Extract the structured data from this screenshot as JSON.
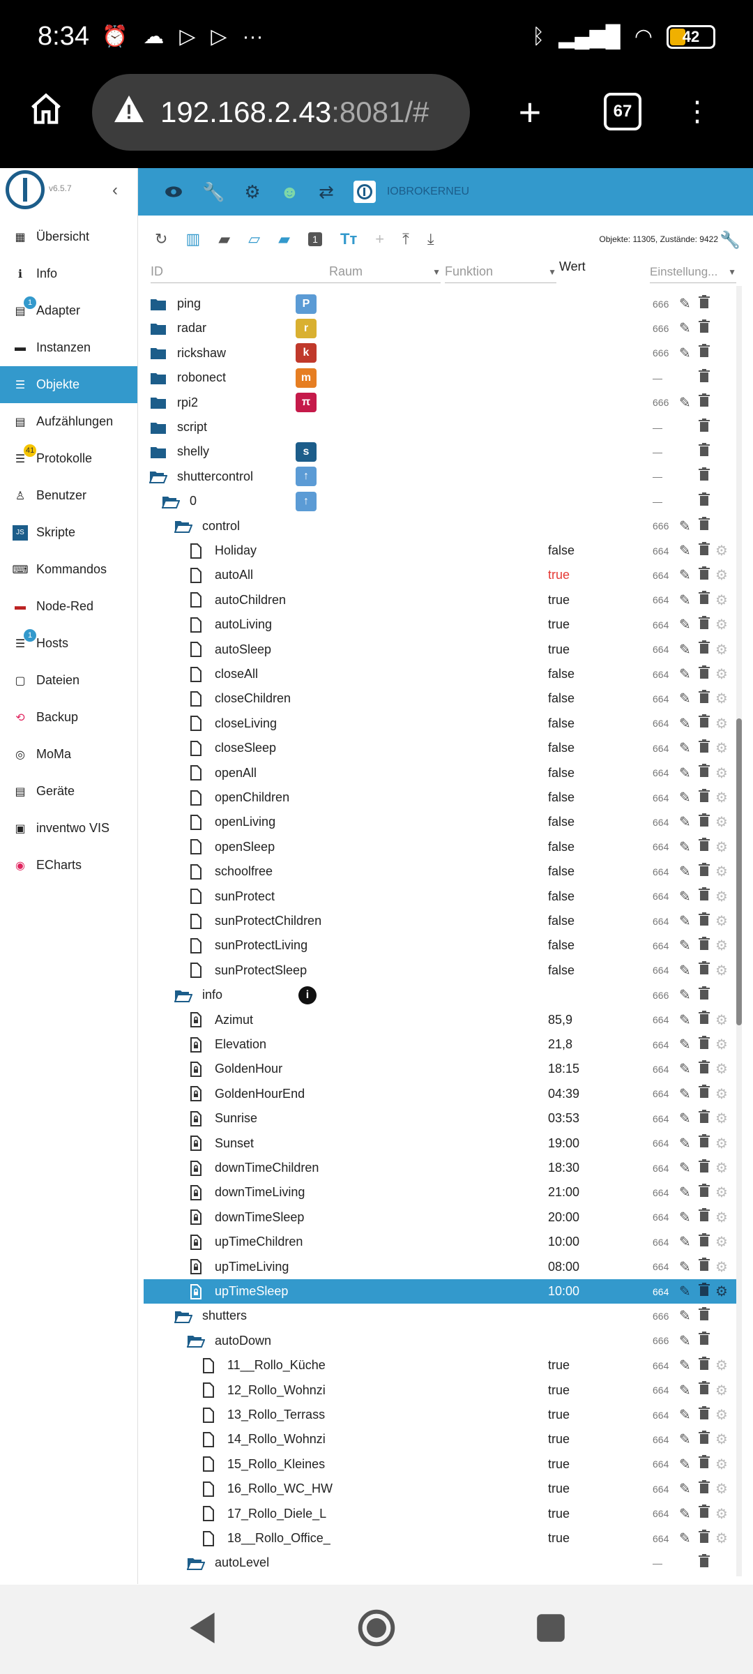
{
  "status": {
    "time": "8:34",
    "battery": "42"
  },
  "browser": {
    "url_host": "192.168.2.43",
    "url_port": ":8081/#",
    "tabs": "67"
  },
  "sidebar": {
    "version": "v6.5.7",
    "items": [
      {
        "label": "Übersicht",
        "icon": "grid-icon"
      },
      {
        "label": "Info",
        "icon": "info-icon"
      },
      {
        "label": "Adapter",
        "icon": "store-icon",
        "badge": "1"
      },
      {
        "label": "Instanzen",
        "icon": "instances-icon"
      },
      {
        "label": "Objekte",
        "icon": "list-icon",
        "active": true
      },
      {
        "label": "Aufzählungen",
        "icon": "enum-icon"
      },
      {
        "label": "Protokolle",
        "icon": "log-icon",
        "badge": "41"
      },
      {
        "label": "Benutzer",
        "icon": "user-icon"
      },
      {
        "label": "Skripte",
        "icon": "js-icon"
      },
      {
        "label": "Kommandos",
        "icon": "console-icon"
      },
      {
        "label": "Node-Red",
        "icon": "nodered-icon"
      },
      {
        "label": "Hosts",
        "icon": "hosts-icon",
        "badge": "1"
      },
      {
        "label": "Dateien",
        "icon": "files-icon"
      },
      {
        "label": "Backup",
        "icon": "backup-icon"
      },
      {
        "label": "MoMa",
        "icon": "moma-icon"
      },
      {
        "label": "Geräte",
        "icon": "devices-icon"
      },
      {
        "label": "inventwo VIS",
        "icon": "vis-icon"
      },
      {
        "label": "ECharts",
        "icon": "echarts-icon"
      }
    ]
  },
  "topbar": {
    "title": "IOBROKERNEU"
  },
  "toolbar": {
    "count": "Objekte: 11305, Zustände: 9422"
  },
  "filters": {
    "id": "ID",
    "room": "Raum",
    "function": "Funktion",
    "value": "Wert",
    "settings": "Einstellung..."
  },
  "rows": [
    {
      "name": "ping",
      "lvl": 0,
      "type": "folder",
      "acl": "666",
      "logo": "P"
    },
    {
      "name": "radar",
      "lvl": 0,
      "type": "folder",
      "acl": "666",
      "logo": "r"
    },
    {
      "name": "rickshaw",
      "lvl": 0,
      "type": "folder",
      "acl": "666",
      "logo": "k"
    },
    {
      "name": "robonect",
      "lvl": 0,
      "type": "folder",
      "acl": "—",
      "logo": "m"
    },
    {
      "name": "rpi2",
      "lvl": 0,
      "type": "folder",
      "acl": "666",
      "logo": "π"
    },
    {
      "name": "script",
      "lvl": 0,
      "type": "folder",
      "acl": "—"
    },
    {
      "name": "shelly",
      "lvl": 0,
      "type": "folder",
      "acl": "—",
      "logo": "s"
    },
    {
      "name": "shuttercontrol",
      "lvl": 0,
      "type": "open",
      "acl": "—",
      "logo": "↑"
    },
    {
      "name": "0",
      "lvl": 1,
      "type": "open",
      "acl": "—",
      "logo": "↑"
    },
    {
      "name": "control",
      "lvl": 2,
      "type": "open",
      "acl": "666"
    },
    {
      "name": "Holiday",
      "lvl": 3,
      "type": "file",
      "val": "false",
      "acl": "664"
    },
    {
      "name": "autoAll",
      "lvl": 3,
      "type": "file",
      "val": "true",
      "red": true,
      "acl": "664"
    },
    {
      "name": "autoChildren",
      "lvl": 3,
      "type": "file",
      "val": "true",
      "acl": "664"
    },
    {
      "name": "autoLiving",
      "lvl": 3,
      "type": "file",
      "val": "true",
      "acl": "664"
    },
    {
      "name": "autoSleep",
      "lvl": 3,
      "type": "file",
      "val": "true",
      "acl": "664"
    },
    {
      "name": "closeAll",
      "lvl": 3,
      "type": "file",
      "val": "false",
      "acl": "664"
    },
    {
      "name": "closeChildren",
      "lvl": 3,
      "type": "file",
      "val": "false",
      "acl": "664"
    },
    {
      "name": "closeLiving",
      "lvl": 3,
      "type": "file",
      "val": "false",
      "acl": "664"
    },
    {
      "name": "closeSleep",
      "lvl": 3,
      "type": "file",
      "val": "false",
      "acl": "664"
    },
    {
      "name": "openAll",
      "lvl": 3,
      "type": "file",
      "val": "false",
      "acl": "664"
    },
    {
      "name": "openChildren",
      "lvl": 3,
      "type": "file",
      "val": "false",
      "acl": "664"
    },
    {
      "name": "openLiving",
      "lvl": 3,
      "type": "file",
      "val": "false",
      "acl": "664"
    },
    {
      "name": "openSleep",
      "lvl": 3,
      "type": "file",
      "val": "false",
      "acl": "664"
    },
    {
      "name": "schoolfree",
      "lvl": 3,
      "type": "file",
      "val": "false",
      "acl": "664"
    },
    {
      "name": "sunProtect",
      "lvl": 3,
      "type": "file",
      "val": "false",
      "acl": "664"
    },
    {
      "name": "sunProtectChildren",
      "lvl": 3,
      "type": "file",
      "val": "false",
      "acl": "664"
    },
    {
      "name": "sunProtectLiving",
      "lvl": 3,
      "type": "file",
      "val": "false",
      "acl": "664"
    },
    {
      "name": "sunProtectSleep",
      "lvl": 3,
      "type": "file",
      "val": "false",
      "acl": "664"
    },
    {
      "name": "info",
      "lvl": 2,
      "type": "open",
      "acl": "666",
      "logo": "i"
    },
    {
      "name": "Azimut",
      "lvl": 3,
      "type": "lock",
      "val": "85,9",
      "acl": "664"
    },
    {
      "name": "Elevation",
      "lvl": 3,
      "type": "lock",
      "val": "21,8",
      "acl": "664"
    },
    {
      "name": "GoldenHour",
      "lvl": 3,
      "type": "lock",
      "val": "18:15",
      "acl": "664"
    },
    {
      "name": "GoldenHourEnd",
      "lvl": 3,
      "type": "lock",
      "val": "04:39",
      "acl": "664"
    },
    {
      "name": "Sunrise",
      "lvl": 3,
      "type": "lock",
      "val": "03:53",
      "acl": "664"
    },
    {
      "name": "Sunset",
      "lvl": 3,
      "type": "lock",
      "val": "19:00",
      "acl": "664"
    },
    {
      "name": "downTimeChildren",
      "lvl": 3,
      "type": "lock",
      "val": "18:30",
      "acl": "664"
    },
    {
      "name": "downTimeLiving",
      "lvl": 3,
      "type": "lock",
      "val": "21:00",
      "acl": "664"
    },
    {
      "name": "downTimeSleep",
      "lvl": 3,
      "type": "lock",
      "val": "20:00",
      "acl": "664"
    },
    {
      "name": "upTimeChildren",
      "lvl": 3,
      "type": "lock",
      "val": "10:00",
      "acl": "664"
    },
    {
      "name": "upTimeLiving",
      "lvl": 3,
      "type": "lock",
      "val": "08:00",
      "acl": "664"
    },
    {
      "name": "upTimeSleep",
      "lvl": 3,
      "type": "lock",
      "val": "10:00",
      "acl": "664",
      "sel": true
    },
    {
      "name": "shutters",
      "lvl": 2,
      "type": "open",
      "acl": "666"
    },
    {
      "name": "autoDown",
      "lvl": 3,
      "type": "open",
      "acl": "666"
    },
    {
      "name": "11__Rollo_Küche",
      "lvl": 4,
      "type": "file",
      "val": "true",
      "acl": "664"
    },
    {
      "name": "12_Rollo_Wohnzi",
      "lvl": 4,
      "type": "file",
      "val": "true",
      "acl": "664"
    },
    {
      "name": "13_Rollo_Terrass",
      "lvl": 4,
      "type": "file",
      "val": "true",
      "acl": "664"
    },
    {
      "name": "14_Rollo_Wohnzi",
      "lvl": 4,
      "type": "file",
      "val": "true",
      "acl": "664"
    },
    {
      "name": "15_Rollo_Kleines",
      "lvl": 4,
      "type": "file",
      "val": "true",
      "acl": "664"
    },
    {
      "name": "16_Rollo_WC_HW",
      "lvl": 4,
      "type": "file",
      "val": "true",
      "acl": "664"
    },
    {
      "name": "17_Rollo_Diele_L",
      "lvl": 4,
      "type": "file",
      "val": "true",
      "acl": "664"
    },
    {
      "name": "18__Rollo_Office_",
      "lvl": 4,
      "type": "file",
      "val": "true",
      "acl": "664"
    },
    {
      "name": "autoLevel",
      "lvl": 3,
      "type": "open",
      "acl": "—"
    }
  ]
}
